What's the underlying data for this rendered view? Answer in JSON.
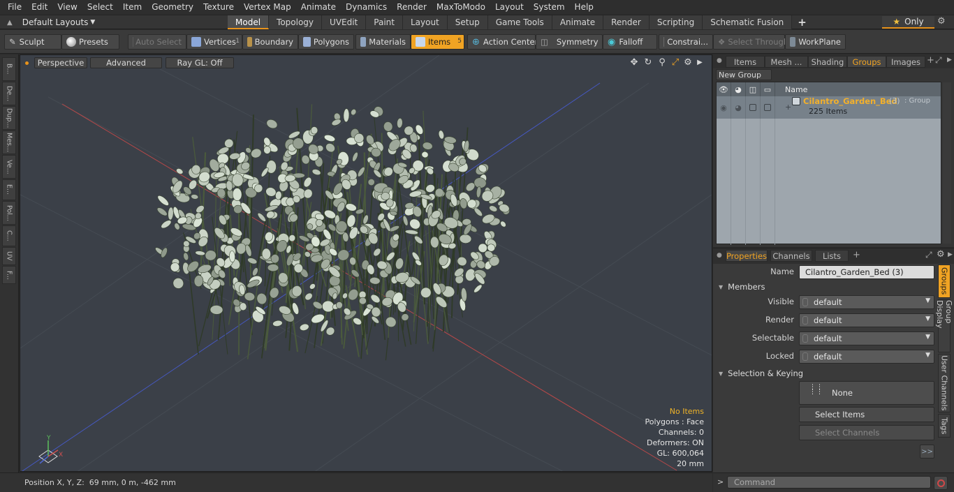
{
  "menu": [
    "File",
    "Edit",
    "View",
    "Select",
    "Item",
    "Geometry",
    "Texture",
    "Vertex Map",
    "Animate",
    "Dynamics",
    "Render",
    "MaxToModo",
    "Layout",
    "System",
    "Help"
  ],
  "layout_selector": "Default Layouts",
  "main_tabs": [
    "Model",
    "Topology",
    "UVEdit",
    "Paint",
    "Layout",
    "Setup",
    "Game Tools",
    "Animate",
    "Render",
    "Scripting",
    "Schematic Fusion"
  ],
  "active_main_tab": "Model",
  "only_label": "Only",
  "toolbar": {
    "sculpt": "Sculpt",
    "presets": "Presets",
    "auto_select": "Auto Select",
    "vertices": "Vertices",
    "vertices_count": "1",
    "boundary": "Boundary",
    "polygons": "Polygons",
    "materials": "Materials",
    "items": "Items",
    "items_count": "5",
    "action_center": "Action Center",
    "symmetry": "Symmetry",
    "falloff": "Falloff",
    "constraints": "Constrai...",
    "select_through": "Select Through",
    "workplane": "WorkPlane"
  },
  "left_tabs": [
    "B...",
    "De...",
    "Dup...",
    "Mes...",
    "Ve...",
    "E...",
    "Pol...",
    "C...",
    "UV",
    "F..."
  ],
  "viewport": {
    "view_mode": "Perspective",
    "shading": "Advanced",
    "raygl": "Ray GL: Off",
    "info": {
      "items": "No Items",
      "polygons": "Polygons : Face",
      "channels": "Channels: 0",
      "deformers": "Deformers: ON",
      "gl": "GL: 600,064",
      "scale": "20 mm"
    }
  },
  "status": "Position X, Y, Z:  69 mm, 0 m, -462 mm",
  "item_list": {
    "tabs": [
      "Items",
      "Mesh ...",
      "Shading",
      "Groups",
      "Images"
    ],
    "active_tab": "Groups",
    "new_group": "New Group",
    "name_header": "Name",
    "group_name": "Cilantro_Garden_Bed",
    "group_count": "(3)",
    "group_type": ": Group",
    "group_items": "225 Items"
  },
  "properties": {
    "tabs": [
      "Properties",
      "Channels",
      "Lists"
    ],
    "active_tab": "Properties",
    "name_label": "Name",
    "name_value": "Cilantro_Garden_Bed (3)",
    "members_section": "Members",
    "visible_label": "Visible",
    "visible_value": "default",
    "render_label": "Render",
    "render_value": "default",
    "selectable_label": "Selectable",
    "selectable_value": "default",
    "locked_label": "Locked",
    "locked_value": "default",
    "selection_section": "Selection & Keying",
    "keying_value": "None",
    "select_items": "Select Items",
    "select_channels": "Select Channels",
    "more": ">>"
  },
  "side_tabs": [
    "Groups",
    "Group Display",
    "User Channels",
    "Tags"
  ],
  "command_placeholder": "Command",
  "colors": {
    "accent": "#f0a323",
    "viewport_bg": "#3b4048",
    "x_axis": "#c04040",
    "z_axis": "#4050c0",
    "foliage": "#c8cfc3"
  }
}
